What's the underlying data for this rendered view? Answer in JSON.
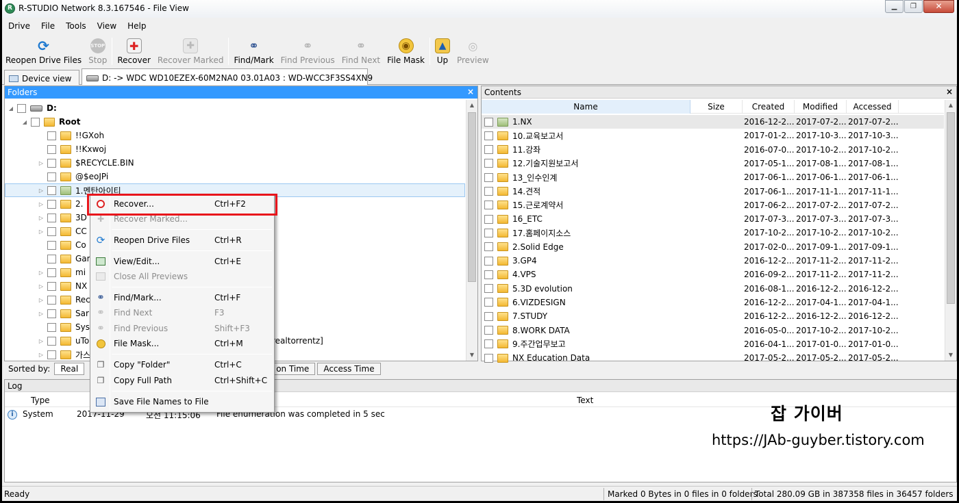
{
  "window": {
    "title": "R-STUDIO Network 8.3.167546 - File View"
  },
  "menubar": [
    "Drive",
    "File",
    "Tools",
    "View",
    "Help"
  ],
  "toolbar": [
    {
      "label": "Reopen Drive Files",
      "icon": "reopen-icon",
      "enabled": true
    },
    {
      "label": "Stop",
      "icon": "stop-icon",
      "enabled": false
    },
    {
      "label": "Recover",
      "icon": "recover-icon",
      "enabled": true
    },
    {
      "label": "Recover Marked",
      "icon": "recover-marked-icon",
      "enabled": false
    },
    {
      "label": "Find/Mark",
      "icon": "binoculars-icon",
      "enabled": true
    },
    {
      "label": "Find Previous",
      "icon": "find-previous-icon",
      "enabled": false
    },
    {
      "label": "Find Next",
      "icon": "find-next-icon",
      "enabled": false
    },
    {
      "label": "File Mask",
      "icon": "file-mask-icon",
      "enabled": true
    },
    {
      "label": "Up",
      "icon": "folder-up-icon",
      "enabled": true
    },
    {
      "label": "Preview",
      "icon": "preview-icon",
      "enabled": false
    }
  ],
  "tabs": {
    "device": "Device view",
    "file": "D: -> WDC WD10EZEX-60M2NA0 03.01A03 : WD-WCC3F3SS4XN9"
  },
  "folders": {
    "title": "Folders",
    "close": "×",
    "items": [
      "D:",
      "Root",
      "!!GXoh",
      "!!Kxwoj",
      "$RECYCLE.BIN",
      "@$eoJPi",
      "1.멘탄아이티",
      "2.",
      "3D",
      "CC",
      "Co",
      "Gar",
      "mi",
      "NX",
      "Rec",
      "Sar",
      "Sys",
      "uTo",
      "가스"
    ],
    "utorrent_suffix": "realtorrentz]"
  },
  "sortbar": {
    "label": "Sorted by:",
    "buttons": [
      "Real",
      "Creation Time",
      "Access Time"
    ],
    "partial_creation": "on Time"
  },
  "contents": {
    "title": "Contents",
    "close": "×",
    "columns": [
      "Name",
      "Size",
      "Created",
      "Modified",
      "Accessed"
    ],
    "rows": [
      [
        "1.NX",
        "2016-12-2...",
        "2017-07-2...",
        "2017-07-2..."
      ],
      [
        "10.교육보고서",
        "2017-01-2...",
        "2017-10-3...",
        "2017-10-3..."
      ],
      [
        "11.강좌",
        "2016-07-0...",
        "2017-10-2...",
        "2017-10-2..."
      ],
      [
        "12.기술지원보고서",
        "2017-05-1...",
        "2017-08-1...",
        "2017-08-1..."
      ],
      [
        "13_인수인계",
        "2017-06-1...",
        "2017-06-1...",
        "2017-06-1..."
      ],
      [
        "14.견적",
        "2017-06-1...",
        "2017-11-1...",
        "2017-11-1..."
      ],
      [
        "15.근로계약서",
        "2017-06-2...",
        "2017-07-2...",
        "2017-07-2..."
      ],
      [
        "16_ETC",
        "2017-07-3...",
        "2017-07-3...",
        "2017-07-3..."
      ],
      [
        "17.홈페이지소스",
        "2017-10-2...",
        "2017-10-2...",
        "2017-10-2..."
      ],
      [
        "2.Solid Edge",
        "2017-02-0...",
        "2017-09-1...",
        "2017-09-1..."
      ],
      [
        "3.GP4",
        "2016-12-2...",
        "2017-11-2...",
        "2017-11-2..."
      ],
      [
        "4.VPS",
        "2016-09-2...",
        "2017-11-2...",
        "2017-11-2..."
      ],
      [
        "5.3D evolution",
        "2016-08-1...",
        "2016-12-2...",
        "2016-12-2..."
      ],
      [
        "6.VIZDESIGN",
        "2016-12-2...",
        "2017-04-1...",
        "2017-04-1..."
      ],
      [
        "7.STUDY",
        "2016-12-2...",
        "2016-12-2...",
        "2016-12-2..."
      ],
      [
        "8.WORK DATA",
        "2016-05-0...",
        "2017-10-2...",
        "2017-10-2..."
      ],
      [
        "9.주간업무보고",
        "2016-04-1...",
        "2017-01-0...",
        "2017-01-0..."
      ],
      [
        "NX Education Data",
        "2017-05-2...",
        "2017-05-2...",
        "2017-05-2..."
      ]
    ]
  },
  "log": {
    "title": "Log",
    "columns": [
      "Type",
      "Text"
    ],
    "row": {
      "type": "System",
      "date": "2017-11-29",
      "time": "오전 11:15:06",
      "text": "File enumeration was completed in 5 sec"
    }
  },
  "context_menu": [
    {
      "label": "Recover...",
      "key": "Ctrl+F2",
      "icon": "recover-icon",
      "enabled": true
    },
    {
      "label": "Recover Marked...",
      "key": "",
      "icon": "recover-marked-icon",
      "enabled": false
    },
    {
      "label": "Reopen Drive Files",
      "key": "Ctrl+R",
      "icon": "reopen-icon",
      "enabled": true
    },
    {
      "label": "View/Edit...",
      "key": "Ctrl+E",
      "icon": "view-edit-icon",
      "enabled": true
    },
    {
      "label": "Close All Previews",
      "key": "",
      "icon": "close-previews-icon",
      "enabled": false
    },
    {
      "label": "Find/Mark...",
      "key": "Ctrl+F",
      "icon": "binoculars-icon",
      "enabled": true
    },
    {
      "label": "Find Next",
      "key": "F3",
      "icon": "find-next-icon",
      "enabled": false
    },
    {
      "label": "Find Previous",
      "key": "Shift+F3",
      "icon": "find-previous-icon",
      "enabled": false
    },
    {
      "label": "File Mask...",
      "key": "Ctrl+M",
      "icon": "file-mask-icon",
      "enabled": true
    },
    {
      "label": "Copy \"Folder\"",
      "key": "Ctrl+C",
      "icon": "copy-icon",
      "enabled": true
    },
    {
      "label": "Copy Full Path",
      "key": "Ctrl+Shift+C",
      "icon": "copy-path-icon",
      "enabled": true
    },
    {
      "label": "Save File Names to File",
      "key": "",
      "icon": "save-names-icon",
      "enabled": true
    }
  ],
  "status": {
    "left": "Ready",
    "marked": "Marked 0 Bytes in 0 files in 0 folders",
    "total": "Total 280.09 GB in 387358 files in 36457 folders"
  },
  "watermark": {
    "name": "잡 가이버",
    "url": "https://JAb-guyber.tistory.com"
  },
  "colors": {
    "accent": "#3399ff",
    "highlight_box": "#e8141b",
    "folder": "#f3b833"
  }
}
